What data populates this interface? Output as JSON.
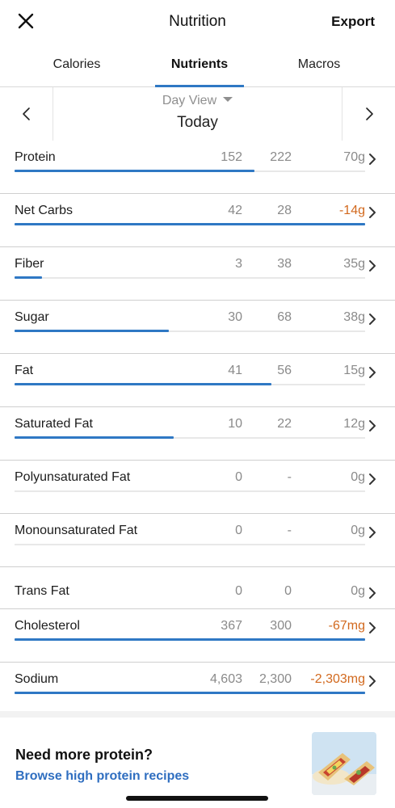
{
  "header": {
    "title": "Nutrition",
    "export_label": "Export",
    "close_icon": "close-icon"
  },
  "tabs": [
    {
      "label": "Calories",
      "active": false
    },
    {
      "label": "Nutrients",
      "active": true
    },
    {
      "label": "Macros",
      "active": false
    }
  ],
  "date_nav": {
    "view_label": "Day View",
    "date_label": "Today"
  },
  "colors": {
    "accent": "#2f78c4",
    "negative": "#d2691e",
    "link": "#2f6ec0"
  },
  "nutrients": [
    {
      "name": "Protein",
      "total": "152",
      "goal": "222",
      "left": "70g",
      "progress": 0.685,
      "negative": false
    },
    {
      "name": "Net Carbs",
      "total": "42",
      "goal": "28",
      "left": "-14g",
      "progress": 1.0,
      "negative": true
    },
    {
      "name": "Fiber",
      "total": "3",
      "goal": "38",
      "left": "35g",
      "progress": 0.079,
      "negative": false
    },
    {
      "name": "Sugar",
      "total": "30",
      "goal": "68",
      "left": "38g",
      "progress": 0.441,
      "negative": false
    },
    {
      "name": "Fat",
      "total": "41",
      "goal": "56",
      "left": "15g",
      "progress": 0.732,
      "negative": false
    },
    {
      "name": "Saturated Fat",
      "total": "10",
      "goal": "22",
      "left": "12g",
      "progress": 0.455,
      "negative": false
    },
    {
      "name": "Polyunsaturated Fat",
      "total": "0",
      "goal": "-",
      "left": "0g",
      "progress": 0,
      "negative": false
    },
    {
      "name": "Monounsaturated Fat",
      "total": "0",
      "goal": "-",
      "left": "0g",
      "progress": 0,
      "negative": false
    },
    {
      "name": "Trans Fat",
      "total": "0",
      "goal": "0",
      "left": "0g",
      "progress": null,
      "negative": false
    },
    {
      "name": "Cholesterol",
      "total": "367",
      "goal": "300",
      "left": "-67mg",
      "progress": 1.0,
      "negative": true
    },
    {
      "name": "Sodium",
      "total": "4,603",
      "goal": "2,300",
      "left": "-2,303mg",
      "progress": 1.0,
      "negative": true
    }
  ],
  "promo": {
    "title": "Need more protein?",
    "link": "Browse high protein recipes",
    "image_icon": "wrap-food-image"
  }
}
